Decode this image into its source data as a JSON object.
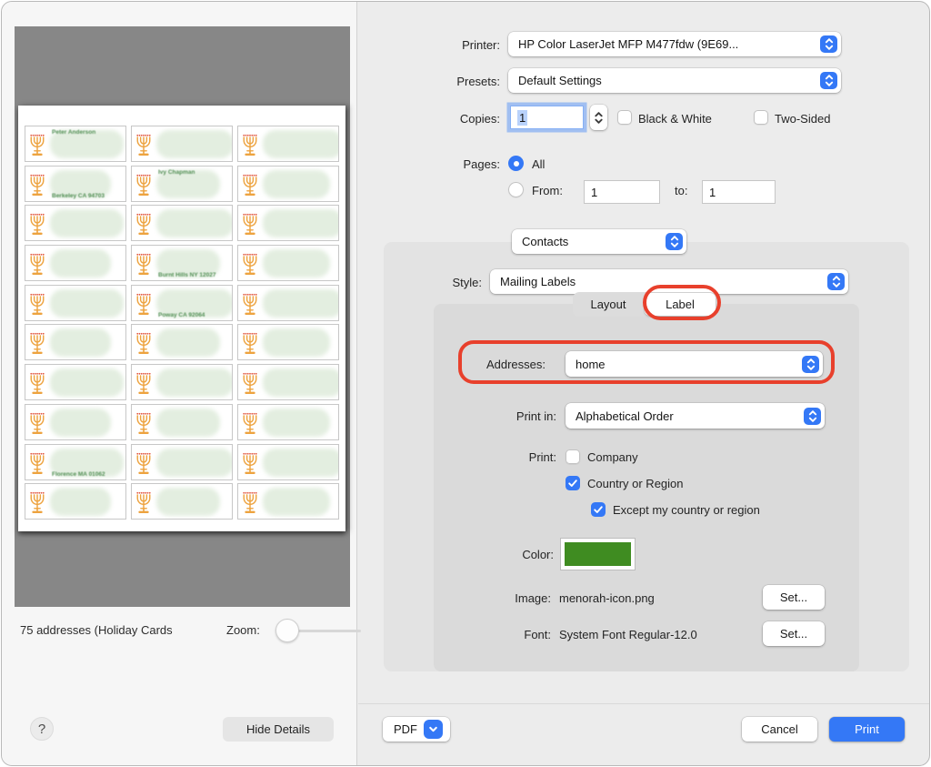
{
  "preview": {
    "status_text": "75 addresses (Holiday Cards",
    "zoom_label": "Zoom:",
    "help_label": "?",
    "hide_details_label": "Hide Details",
    "page": {
      "rows": 10,
      "cols": 3
    },
    "legible_cells": [
      {
        "row": 1,
        "col": 1,
        "name": "Peter Anderson"
      },
      {
        "row": 2,
        "col": 1,
        "city": "Berkeley CA 94703"
      },
      {
        "row": 2,
        "col": 2,
        "name": "Ivy Chapman"
      },
      {
        "row": 4,
        "col": 2,
        "city": "Burnt Hills NY 12027"
      },
      {
        "row": 5,
        "col": 2,
        "city": "Poway CA 92064"
      },
      {
        "row": 9,
        "col": 1,
        "city": "Florence MA 01062"
      }
    ]
  },
  "dialog": {
    "printer": {
      "label": "Printer:",
      "value": "HP Color LaserJet MFP M477fdw (9E69..."
    },
    "presets": {
      "label": "Presets:",
      "value": "Default Settings"
    },
    "copies": {
      "label": "Copies:",
      "value": "1",
      "black_white_label": "Black & White",
      "black_white_checked": false,
      "two_sided_label": "Two-Sided",
      "two_sided_checked": false
    },
    "pages": {
      "label": "Pages:",
      "all_label": "All",
      "all_selected": true,
      "from_label": "From:",
      "from_value": "1",
      "to_label": "to:",
      "to_value": "1"
    },
    "app_popup_value": "Contacts",
    "style": {
      "label": "Style:",
      "value": "Mailing Labels"
    },
    "tabs": {
      "layout": "Layout",
      "label": "Label",
      "selected": "Label"
    },
    "addresses": {
      "label": "Addresses:",
      "value": "home"
    },
    "print_in": {
      "label": "Print in:",
      "value": "Alphabetical Order"
    },
    "print_options": {
      "label": "Print:",
      "company": "Company",
      "company_checked": false,
      "country": "Country or Region",
      "country_checked": true,
      "except": "Except my country or region",
      "except_checked": true
    },
    "color": {
      "label": "Color:",
      "swatch_hex": "#3f8c21"
    },
    "image": {
      "label": "Image:",
      "value": "menorah-icon.png",
      "set_label": "Set..."
    },
    "font": {
      "label": "Font:",
      "value": "System Font Regular-12.0",
      "set_label": "Set..."
    },
    "footer": {
      "pdf_label": "PDF",
      "cancel_label": "Cancel",
      "print_label": "Print"
    }
  },
  "colors": {
    "accent_blue": "#3478f6",
    "annotation_red": "#e8402c",
    "swatch_green": "#3f8c21",
    "preview_background": "#878787"
  }
}
